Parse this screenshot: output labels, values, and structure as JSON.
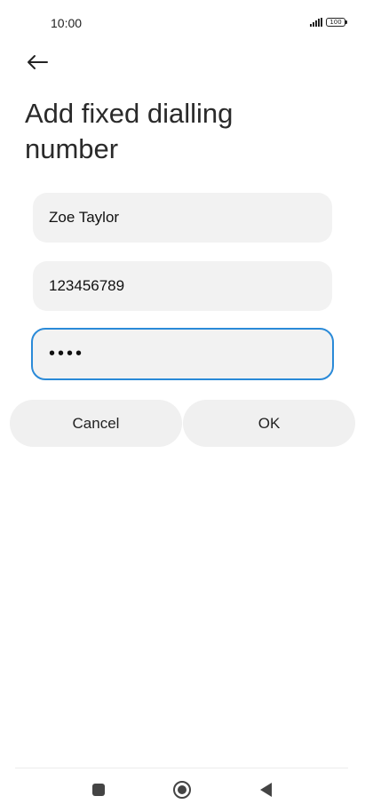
{
  "status_bar": {
    "time": "10:00",
    "battery": "100"
  },
  "header": {
    "title": "Add fixed dialling number"
  },
  "form": {
    "name_value": "Zoe Taylor",
    "number_value": "123456789",
    "pin_masked": "••••"
  },
  "actions": {
    "cancel_label": "Cancel",
    "ok_label": "OK"
  },
  "colors": {
    "accent": "#2a8ad8",
    "field_bg": "#f2f2f2",
    "button_bg": "#f0f0f0"
  },
  "icons": {
    "back": "back-arrow-icon",
    "signal": "signal-icon",
    "battery": "battery-icon",
    "recents": "square-icon",
    "home": "home-icon",
    "nav_back": "triangle-back-icon"
  }
}
